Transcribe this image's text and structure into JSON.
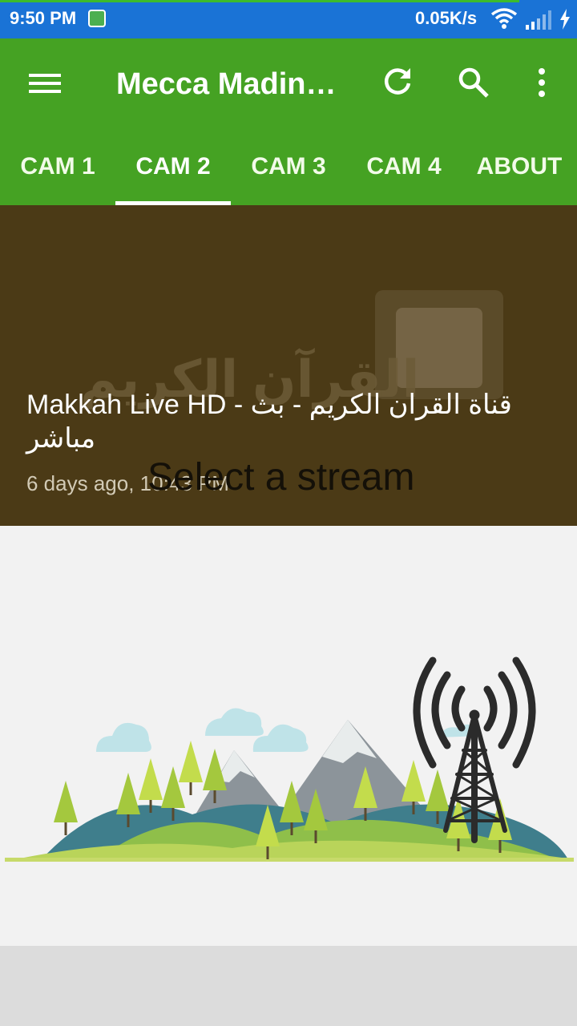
{
  "status_bar": {
    "time": "9:50 PM",
    "speed": "0.05K/s",
    "icons": [
      "app-notification-icon",
      "wifi-icon",
      "signal-icon",
      "battery-charging-icon"
    ],
    "color": "#1a73d6"
  },
  "app_bar": {
    "title": "Mecca Madin…",
    "color": "#45a223",
    "icons": [
      "menu-icon",
      "refresh-icon",
      "search-icon",
      "more-vert-icon"
    ]
  },
  "tabs": [
    {
      "label": "CAM 1",
      "active": false
    },
    {
      "label": "CAM 2",
      "active": true
    },
    {
      "label": "CAM 3",
      "active": false
    },
    {
      "label": "CAM 4",
      "active": false
    },
    {
      "label": "ABOUT",
      "active": false
    }
  ],
  "video": {
    "title": "Makkah Live HD - قناة القران الكريم - بث مباشر",
    "date": "6 days ago, 10:43 PM",
    "watermark": "القرآن الكريم",
    "overlay_text": "Select a stream"
  },
  "illustration": {
    "icons": [
      "cloud-icon",
      "mountain-icon",
      "tree-icon",
      "radio-tower-icon"
    ]
  }
}
